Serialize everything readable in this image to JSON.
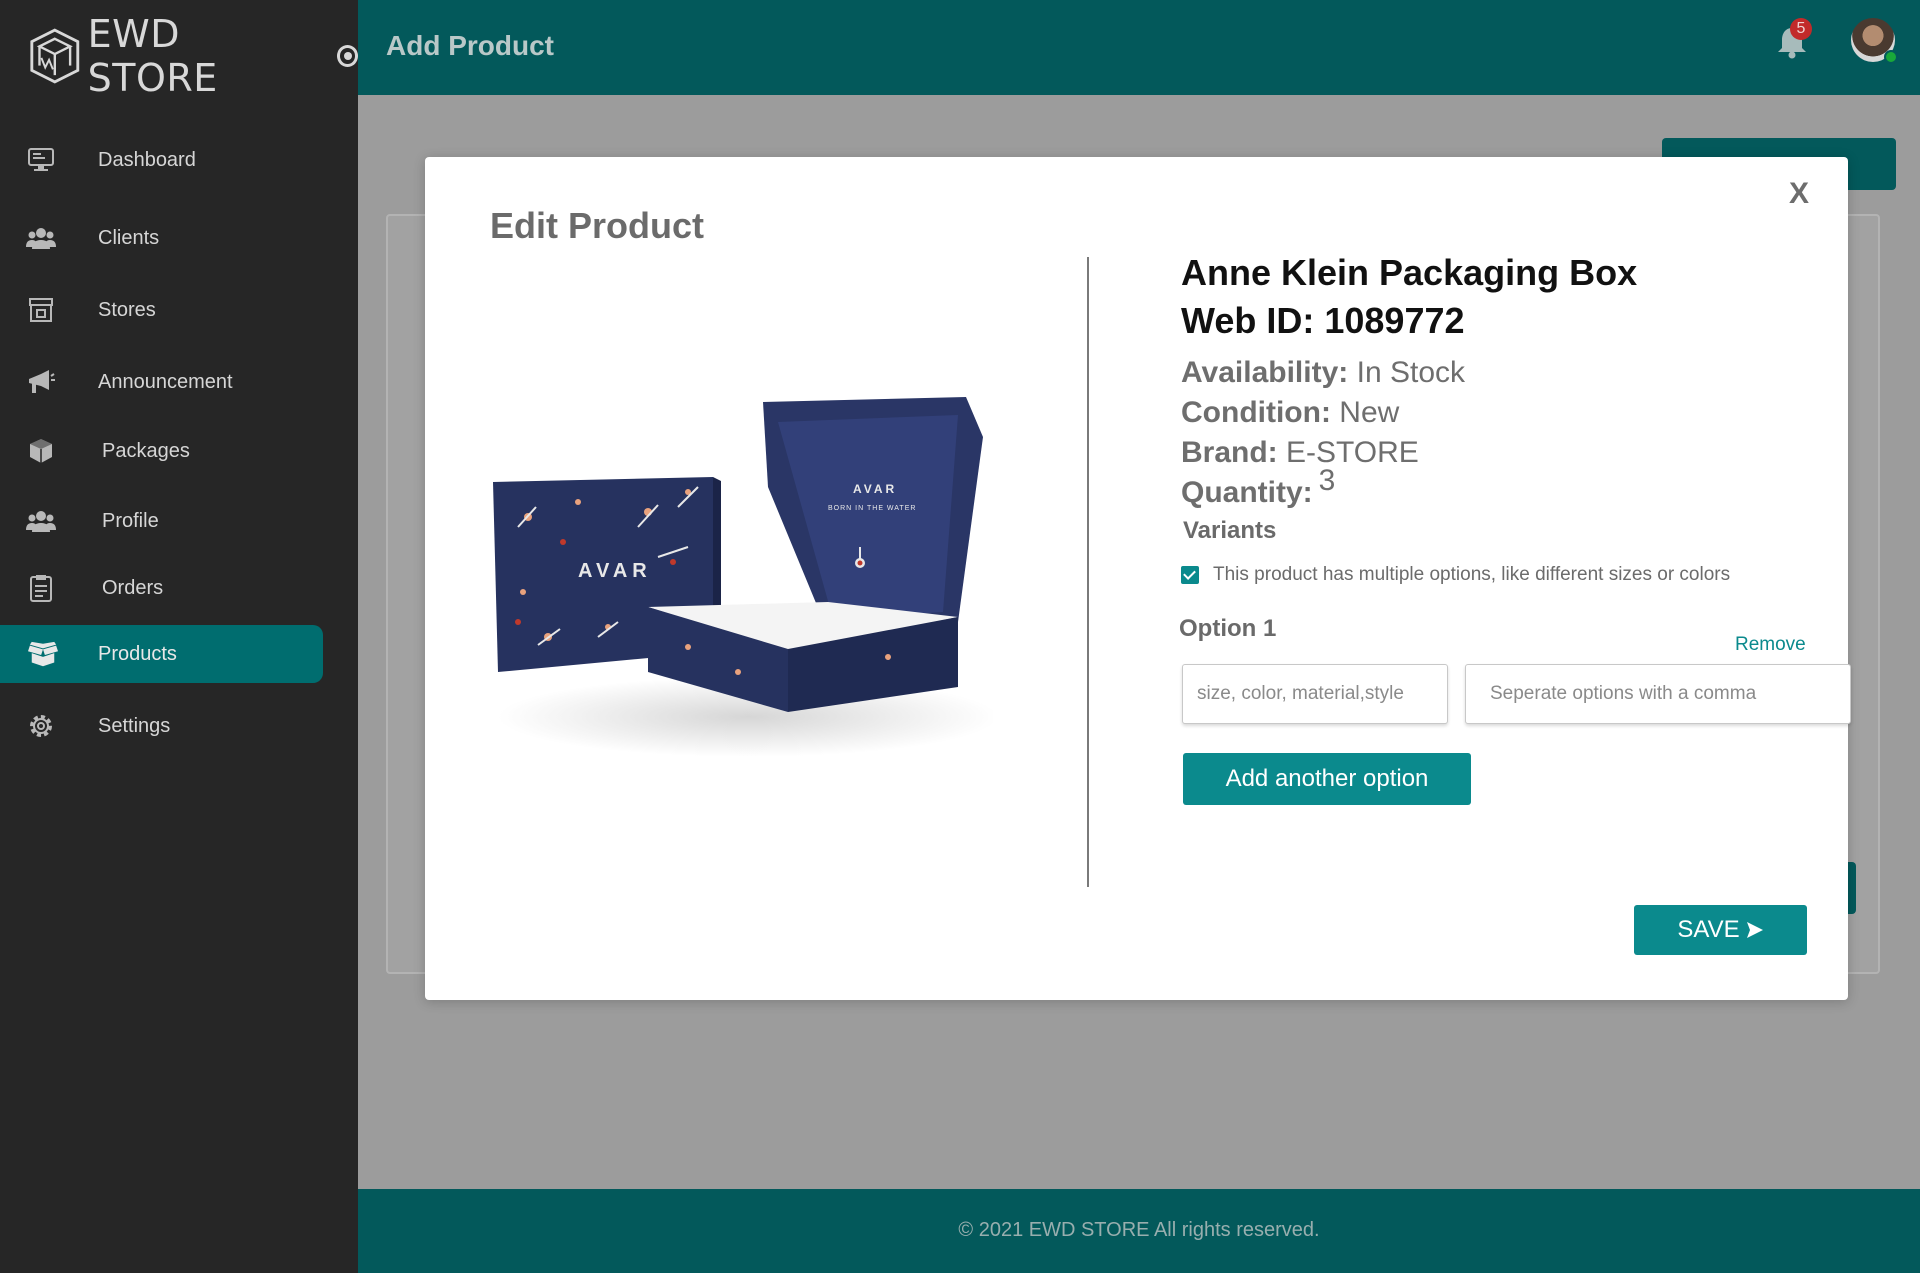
{
  "app": {
    "brand_name": "EWD STORE",
    "page_title": "Add Product",
    "notification_count": "5",
    "footer": "© 2021 EWD STORE  All rights reserved."
  },
  "sidebar": {
    "items": [
      {
        "label": "Dashboard",
        "icon": "monitor-icon"
      },
      {
        "label": "Clients",
        "icon": "users-icon"
      },
      {
        "label": "Stores",
        "icon": "store-icon"
      },
      {
        "label": "Announcement",
        "icon": "megaphone-icon"
      },
      {
        "label": "Packages",
        "icon": "boxes-icon"
      },
      {
        "label": "Profile",
        "icon": "users-icon"
      },
      {
        "label": "Orders",
        "icon": "clipboard-icon"
      },
      {
        "label": "Products",
        "icon": "box-icon",
        "active": true
      },
      {
        "label": "Settings",
        "icon": "gear-icon"
      }
    ]
  },
  "modal": {
    "title": "Edit Product",
    "close_label": "X",
    "product": {
      "name": "Anne Klein  Packaging Box",
      "web_id_label": "Web ID:",
      "web_id": "1089772",
      "availability_label": "Availability:",
      "availability": "In Stock",
      "condition_label": "Condition:",
      "condition": "New",
      "brand_label": "Brand:",
      "brand": "E-STORE",
      "quantity_label": "Quantity:",
      "quantity": "3",
      "image_text_big": "AVAR",
      "image_text_small": "BORN IN THE WATER"
    },
    "variants": {
      "heading": "Variants",
      "multiple_options_label": "This product has multiple options, like different sizes or colors",
      "multiple_options_checked": true,
      "option_label": "Option 1",
      "remove_label": "Remove",
      "name_placeholder": "size, color, material,style",
      "values_placeholder": "Seperate options with a comma",
      "add_option_label": "Add another option"
    },
    "save_label": "SAVE"
  },
  "colors": {
    "teal_dark": "#03595b",
    "teal": "#0b8a8d",
    "sidebar": "#262626"
  }
}
